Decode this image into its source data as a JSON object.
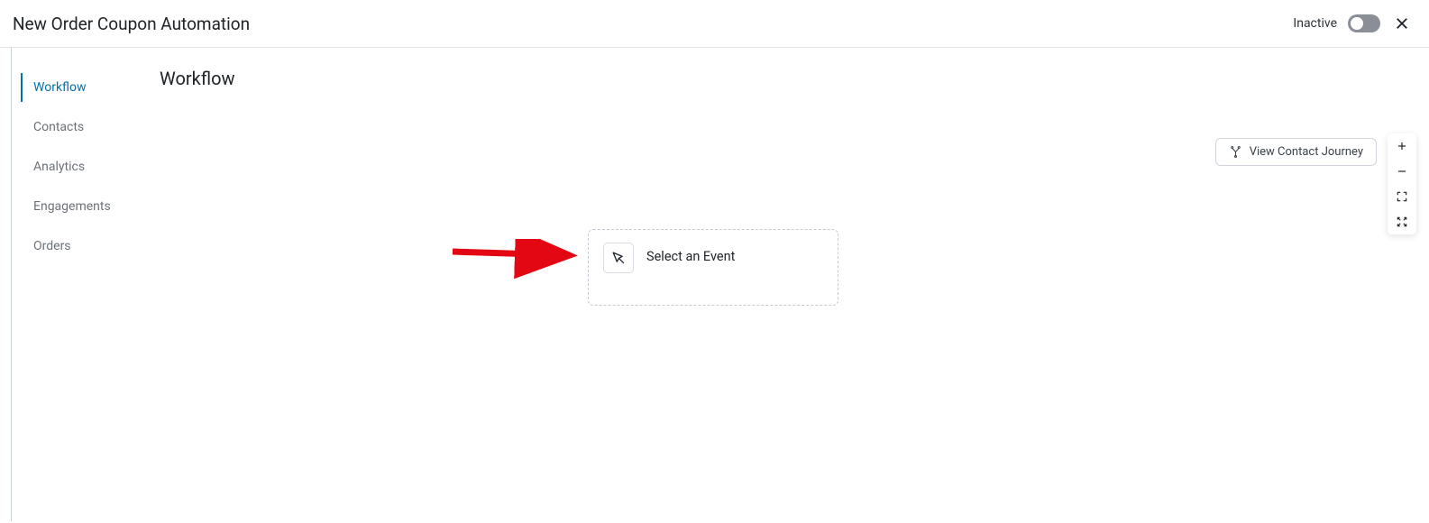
{
  "header": {
    "title": "New Order Coupon Automation",
    "status_label": "Inactive",
    "toggle_state": false
  },
  "sidebar": {
    "items": [
      {
        "id": "workflow",
        "label": "Workflow",
        "active": true
      },
      {
        "id": "contacts",
        "label": "Contacts",
        "active": false
      },
      {
        "id": "analytics",
        "label": "Analytics",
        "active": false
      },
      {
        "id": "engagements",
        "label": "Engagements",
        "active": false
      },
      {
        "id": "orders",
        "label": "Orders",
        "active": false
      }
    ]
  },
  "main": {
    "heading": "Workflow",
    "view_journey_label": "View Contact Journey",
    "event_card_label": "Select an Event"
  }
}
